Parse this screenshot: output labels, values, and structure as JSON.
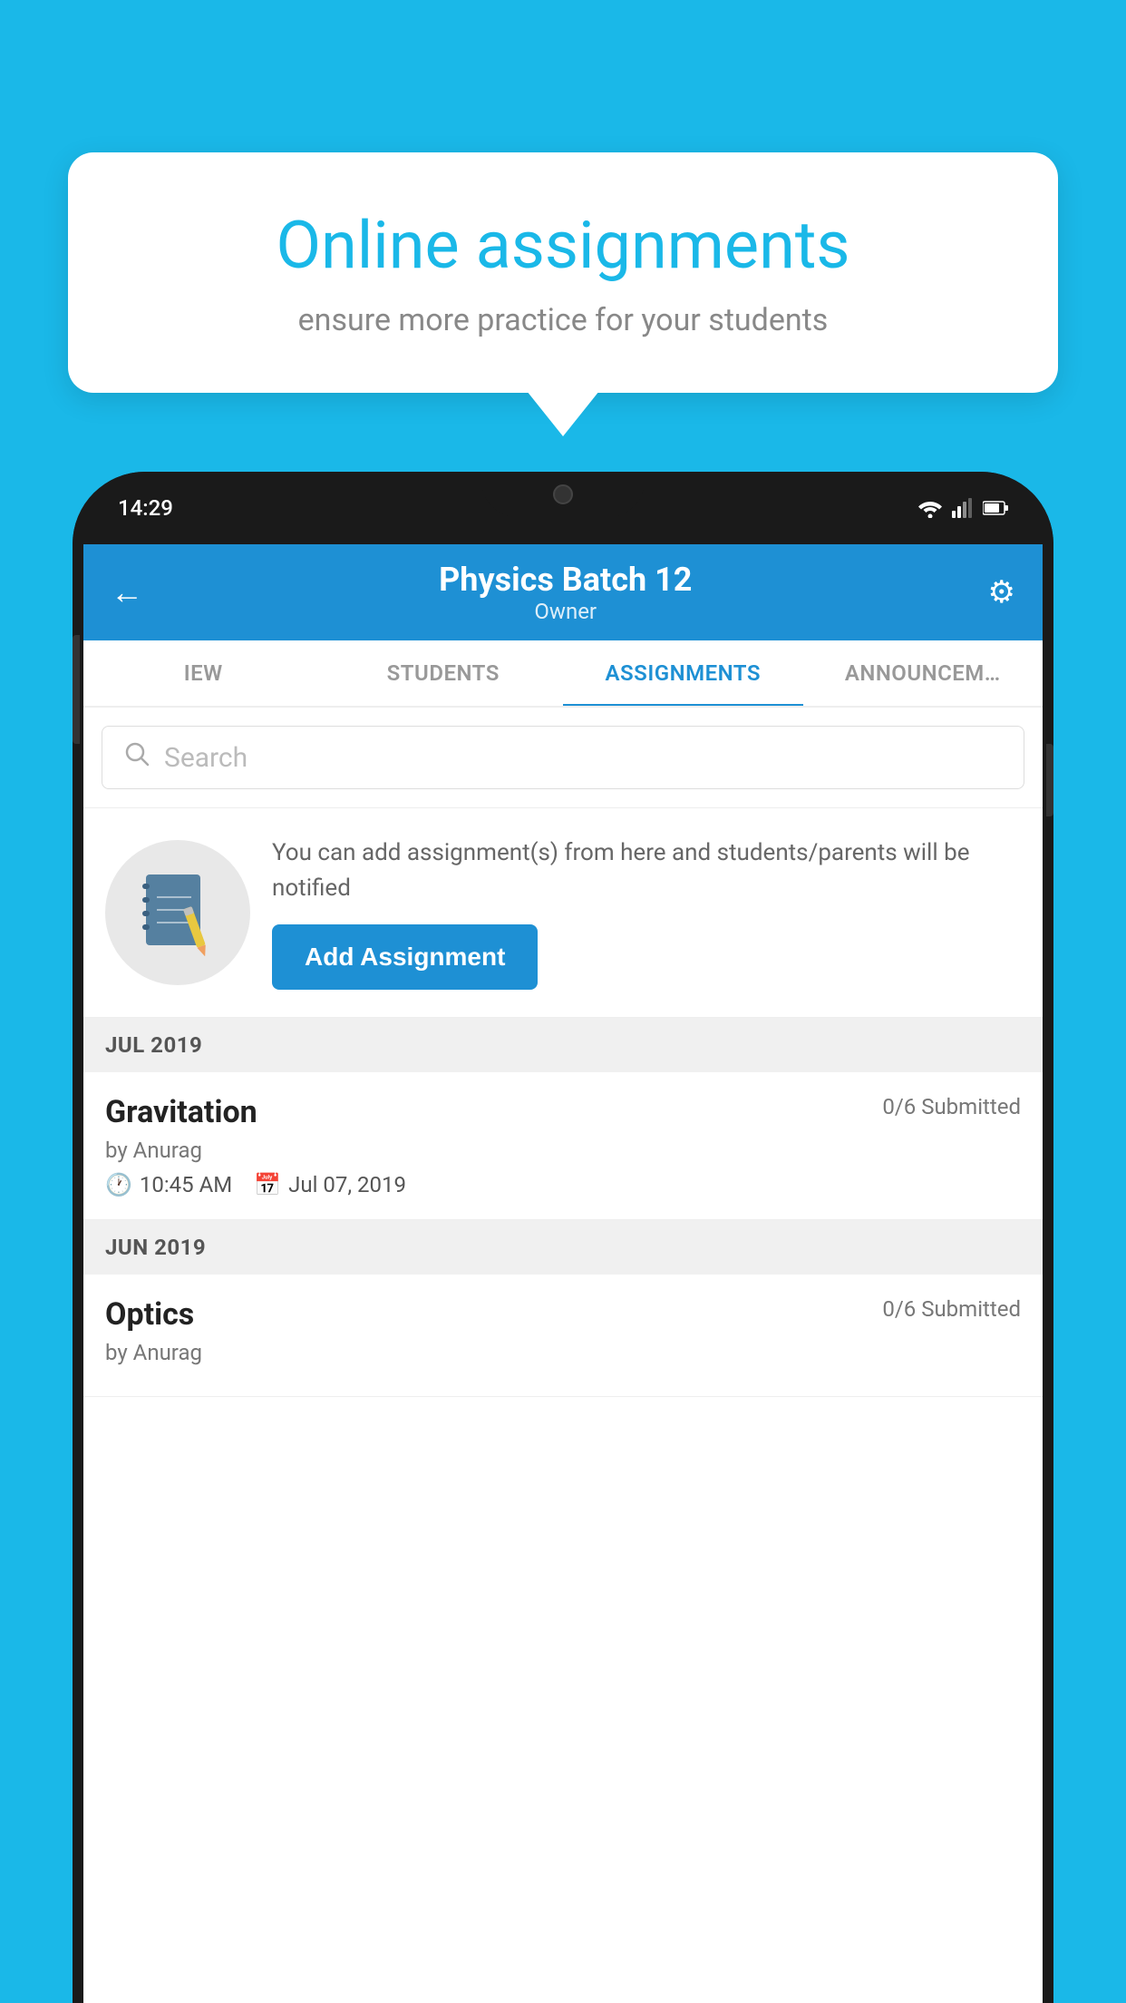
{
  "background": {
    "color": "#1ab8e8"
  },
  "speech_bubble": {
    "title": "Online assignments",
    "subtitle": "ensure more practice for your students"
  },
  "phone": {
    "status_bar": {
      "time": "14:29"
    },
    "header": {
      "title": "Physics Batch 12",
      "subtitle": "Owner",
      "back_label": "←",
      "settings_label": "⚙"
    },
    "tabs": [
      {
        "label": "IEW",
        "active": false
      },
      {
        "label": "STUDENTS",
        "active": false
      },
      {
        "label": "ASSIGNMENTS",
        "active": true
      },
      {
        "label": "ANNOUNCEM…",
        "active": false
      }
    ],
    "search": {
      "placeholder": "Search"
    },
    "add_assignment": {
      "description": "You can add assignment(s) from here and students/parents will be notified",
      "button_label": "Add Assignment"
    },
    "sections": [
      {
        "header": "JUL 2019",
        "items": [
          {
            "name": "Gravitation",
            "submitted": "0/6 Submitted",
            "by": "by Anurag",
            "time": "10:45 AM",
            "date": "Jul 07, 2019"
          }
        ]
      },
      {
        "header": "JUN 2019",
        "items": [
          {
            "name": "Optics",
            "submitted": "0/6 Submitted",
            "by": "by Anurag",
            "time": "",
            "date": ""
          }
        ]
      }
    ]
  }
}
